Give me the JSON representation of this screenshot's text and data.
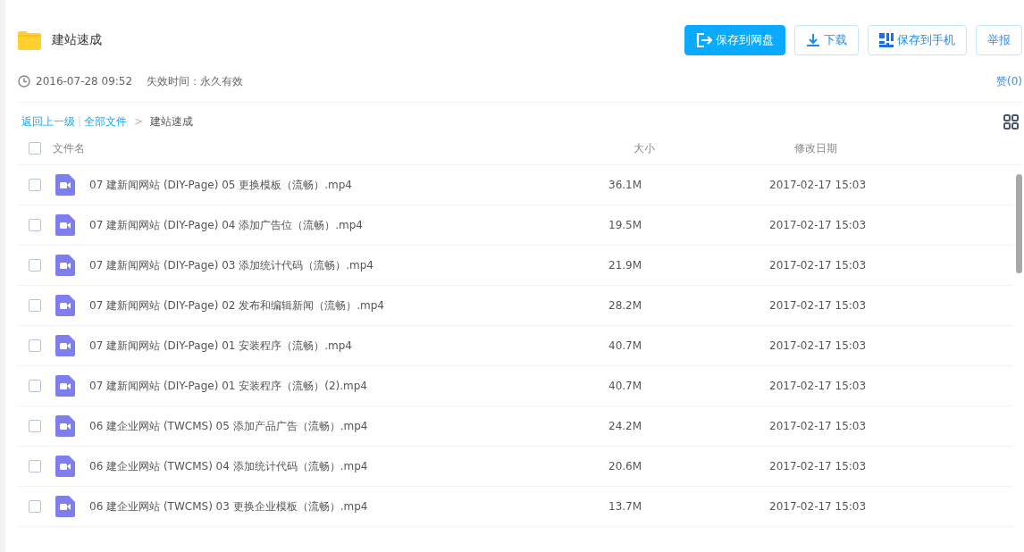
{
  "title": "建站速成",
  "actions": [
    {
      "label": "保存到网盘",
      "kind": "save"
    },
    {
      "label": "下载",
      "kind": "download"
    },
    {
      "label": "保存到手机",
      "kind": "phone"
    },
    {
      "label": "举报",
      "kind": "report"
    }
  ],
  "meta": {
    "date": "2016-07-28 09:52",
    "expiry": "失效时间：永久有效",
    "likes": "赞(0)"
  },
  "breadcrumb": {
    "back": "返回上一级",
    "separator": "|",
    "root": "全部文件",
    "arrow": ">",
    "current": "建站速成"
  },
  "table": {
    "columns": [
      "文件名",
      "大小",
      "修改日期"
    ],
    "all_checked": false,
    "rows": [
      {
        "name": "07 建新闻网站 (DIY-Page) 05 更换模板（流畅）.mp4",
        "size": "36.1M",
        "date": "2017-02-17 15:03",
        "checked": false
      },
      {
        "name": "07 建新闻网站 (DIY-Page) 04 添加广告位（流畅）.mp4",
        "size": "19.5M",
        "date": "2017-02-17 15:03",
        "checked": false
      },
      {
        "name": "07 建新闻网站 (DIY-Page) 03 添加统计代码（流畅）.mp4",
        "size": "21.9M",
        "date": "2017-02-17 15:03",
        "checked": false
      },
      {
        "name": "07 建新闻网站 (DIY-Page) 02 发布和编辑新闻（流畅）.mp4",
        "size": "28.2M",
        "date": "2017-02-17 15:03",
        "checked": false
      },
      {
        "name": "07 建新闻网站 (DIY-Page) 01 安装程序（流畅）.mp4",
        "size": "40.7M",
        "date": "2017-02-17 15:03",
        "checked": false
      },
      {
        "name": "07 建新闻网站 (DIY-Page) 01 安装程序（流畅）(2).mp4",
        "size": "40.7M",
        "date": "2017-02-17 15:03",
        "checked": false
      },
      {
        "name": "06 建企业网站 (TWCMS) 05 添加产品广告（流畅）.mp4",
        "size": "24.2M",
        "date": "2017-02-17 15:03",
        "checked": false
      },
      {
        "name": "06 建企业网站 (TWCMS) 04 添加统计代码（流畅）.mp4",
        "size": "20.6M",
        "date": "2017-02-17 15:03",
        "checked": false
      },
      {
        "name": "06 建企业网站 (TWCMS) 03 更换企业模板（流畅）.mp4",
        "size": "13.7M",
        "date": "2017-02-17 15:03",
        "checked": false
      }
    ]
  }
}
